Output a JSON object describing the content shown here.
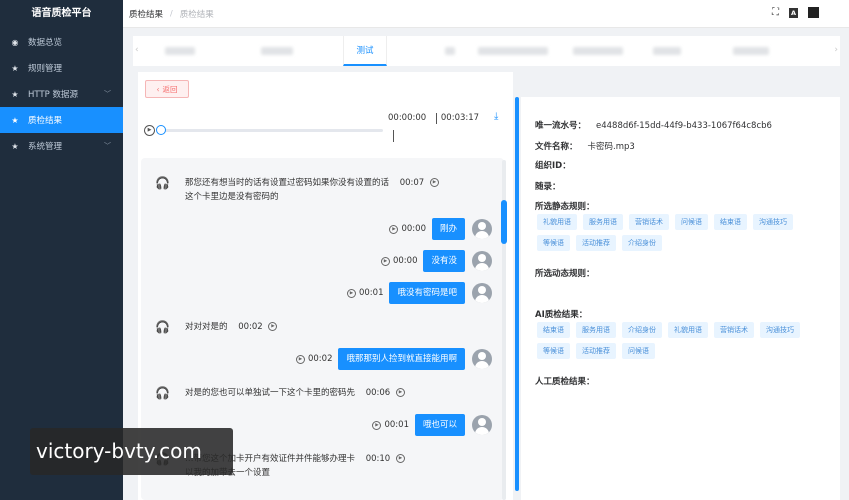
{
  "app": {
    "title": "语音质检平台"
  },
  "sidebar": {
    "items": [
      {
        "label": "数据总览",
        "icon": "dashboard-icon"
      },
      {
        "label": "规则管理",
        "icon": "star-icon"
      },
      {
        "label": "HTTP 数据源",
        "icon": "star-icon",
        "has_submenu": true
      },
      {
        "label": "质检结果",
        "icon": "star-icon",
        "active": true
      },
      {
        "label": "系统管理",
        "icon": "star-icon",
        "has_submenu": true
      }
    ]
  },
  "breadcrumb": {
    "parent": "质检结果",
    "current": "质检结果"
  },
  "tabs": {
    "active_label": "测试"
  },
  "back_button": {
    "label": "返回"
  },
  "audio": {
    "current": "00:00:00",
    "total": "00:03:17"
  },
  "conversation": [
    {
      "side": "left",
      "lines": [
        "那您还有想当时的话有设置过密码如果你没有设置的话",
        "这个卡里边是没有密码的"
      ],
      "time": "00:07"
    },
    {
      "side": "right",
      "text": "刚办",
      "time": "00:00"
    },
    {
      "side": "right",
      "text": "没有没",
      "time": "00:00"
    },
    {
      "side": "right",
      "text": "哦没有密码是吧",
      "time": "00:01"
    },
    {
      "side": "left",
      "lines": [
        "对对对是的"
      ],
      "time": "00:02"
    },
    {
      "side": "right",
      "text": "哦那那别人捡到就直接能用啊",
      "time": "00:02"
    },
    {
      "side": "left",
      "lines": [
        "对是的您也可以单独试一下这个卡里的密码先"
      ],
      "time": "00:06"
    },
    {
      "side": "right",
      "text": "哦也可以",
      "time": "00:01"
    },
    {
      "side": "left",
      "lines": [
        "…带您这个加卡开户有效证件并件能够办理卡",
        "以我的加带去一个设置"
      ],
      "time": "00:10"
    }
  ],
  "details": {
    "serial_label": "唯一流水号：",
    "serial_value": "e4488d6f-15dd-44f9-b433-1067f64c8cb6",
    "filename_label": "文件名称：",
    "filename_value": "卡密码.mp3",
    "org_label": "组织ID：",
    "tag_label": "随录：",
    "static_rules_label": "所选静态规则：",
    "static_rules": [
      "礼貌用语",
      "服务用语",
      "营销话术",
      "问候语",
      "结束语",
      "沟通技巧",
      "等候语",
      "活动推荐",
      "介绍身份"
    ],
    "dynamic_rules_label": "所选动态规则：",
    "ai_result_label": "AI质检结果：",
    "ai_results": [
      "结束语",
      "服务用语",
      "介绍身份",
      "礼貌用语",
      "营销话术",
      "沟通技巧",
      "等候语",
      "活动推荐",
      "问候语"
    ],
    "manual_result_label": "人工质检结果："
  },
  "watermark": {
    "text": "victory-bvty.com"
  }
}
